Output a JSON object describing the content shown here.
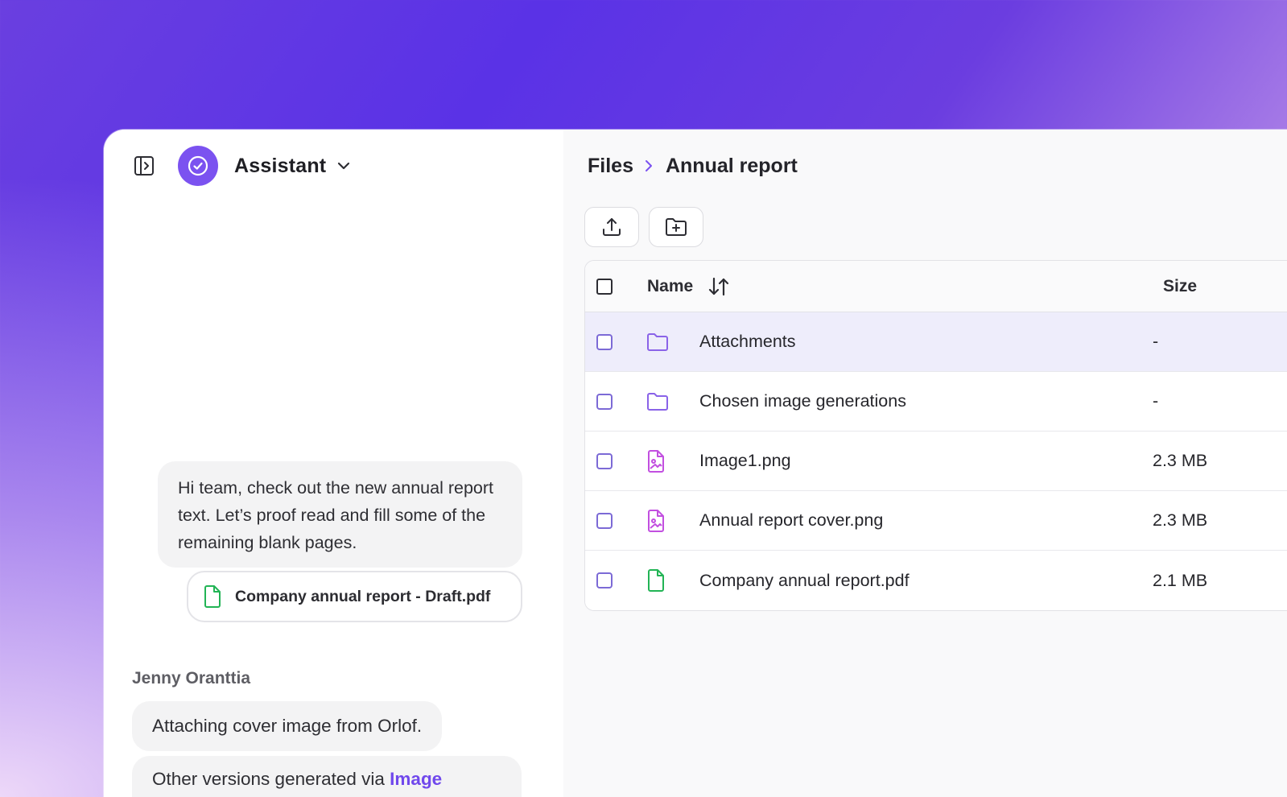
{
  "assistant": {
    "title": "Assistant"
  },
  "chat": {
    "message1": "Hi team, check out the new annual report text. Let’s proof read and fill some of the remaining blank pages.",
    "attachment_label": "Company annual report - Draft.pdf",
    "sender": "Jenny Oranttia",
    "message2": "Attaching cover image from Orlof.",
    "message3_prefix": "Other versions generated via ",
    "message3_link": "Image"
  },
  "breadcrumb": {
    "root": "Files",
    "current": "Annual report"
  },
  "table": {
    "columns": {
      "name": "Name",
      "size": "Size"
    },
    "rows": [
      {
        "name": "Attachments",
        "size": "-",
        "type": "folder",
        "icon": "folder-icon",
        "selected": true
      },
      {
        "name": "Chosen image generations",
        "size": "-",
        "type": "folder",
        "icon": "folder-icon",
        "selected": false
      },
      {
        "name": "Image1.png",
        "size": "2.3 MB",
        "type": "image",
        "icon": "image-file-icon",
        "selected": false
      },
      {
        "name": "Annual report cover.png",
        "size": "2.3 MB",
        "type": "image",
        "icon": "image-file-icon",
        "selected": false
      },
      {
        "name": "Company annual report.pdf",
        "size": "2.1 MB",
        "type": "document",
        "icon": "document-file-icon",
        "selected": false
      }
    ]
  },
  "colors": {
    "accent": "#7b52f0",
    "folder_icon": "#8a63e8",
    "image_icon": "#c24fe0",
    "document_icon": "#22b455",
    "selected_row": "#eeedfb"
  }
}
